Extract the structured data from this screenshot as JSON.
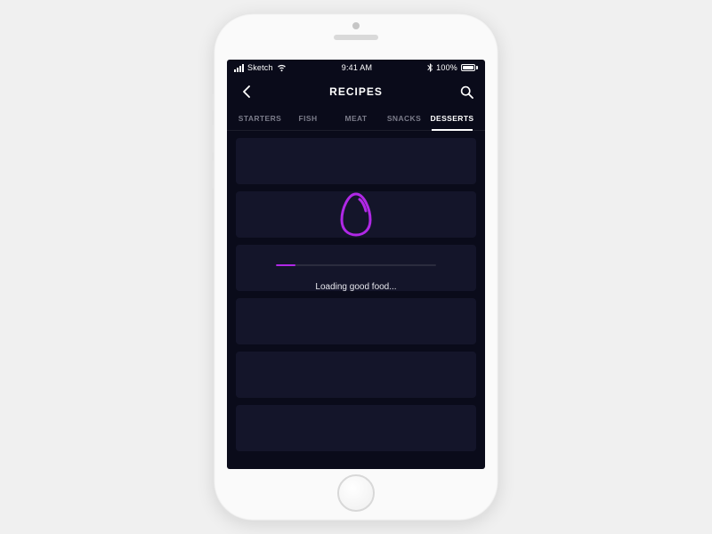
{
  "status": {
    "carrier": "Sketch",
    "time": "9:41 AM",
    "battery_pct": "100%"
  },
  "nav": {
    "title": "RECIPES"
  },
  "tabs": [
    {
      "label": "STARTERS",
      "active": false
    },
    {
      "label": "FISH",
      "active": false
    },
    {
      "label": "MEAT",
      "active": false
    },
    {
      "label": "SNACKS",
      "active": false
    },
    {
      "label": "DESSERTS",
      "active": true
    }
  ],
  "loading": {
    "text": "Loading good food...",
    "progress_pct": 12,
    "icon": "egg",
    "accent_color": "#b028e6"
  },
  "placeholder_count": 6
}
